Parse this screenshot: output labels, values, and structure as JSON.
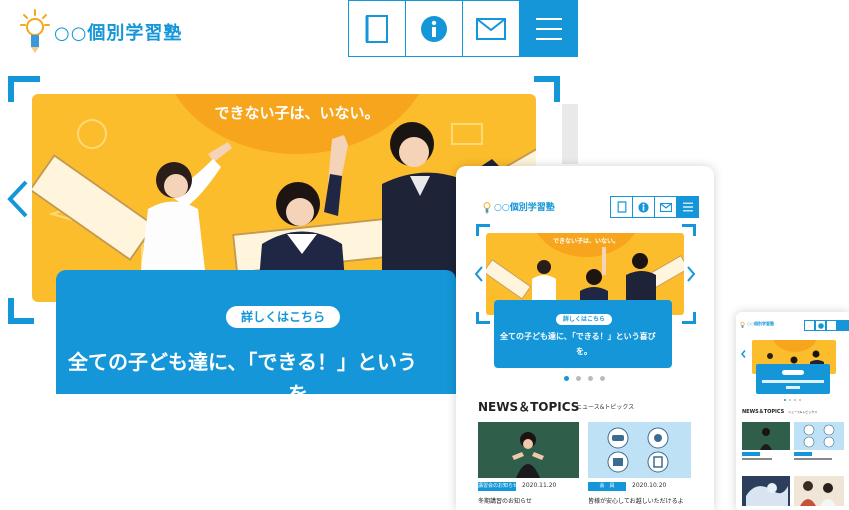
{
  "site": {
    "name": "○○個別学習塾"
  },
  "nav": {
    "items": [
      {
        "icon": "document-icon"
      },
      {
        "icon": "info-icon"
      },
      {
        "icon": "mail-icon"
      },
      {
        "icon": "hamburger-menu-icon"
      }
    ]
  },
  "hero": {
    "headline": "できない子は、いない。",
    "button_label": "詳しくはこちら",
    "catch_line1": "全ての子ども達に、「できる！」という",
    "catch_line2": "を。",
    "catch_medium_line1": "全ての子ども達に、「できる！」という喜び",
    "catch_medium_line2": "を。",
    "slider": {
      "count": 4,
      "active_index": 0
    }
  },
  "news": {
    "heading": "NEWS＆TOPICS",
    "subheading": "ニュース&トピックス",
    "items": [
      {
        "category": "講習会のお知らせ",
        "date": "2020.11.20",
        "title": "冬期講習のお知らせ"
      },
      {
        "category": "会　員",
        "date": "2020.10.20",
        "title": "皆様が安心してお越しいただけるよ"
      }
    ]
  },
  "colors": {
    "brand_blue": "#1496d8",
    "hero_yellow": "#fcbd2c"
  }
}
